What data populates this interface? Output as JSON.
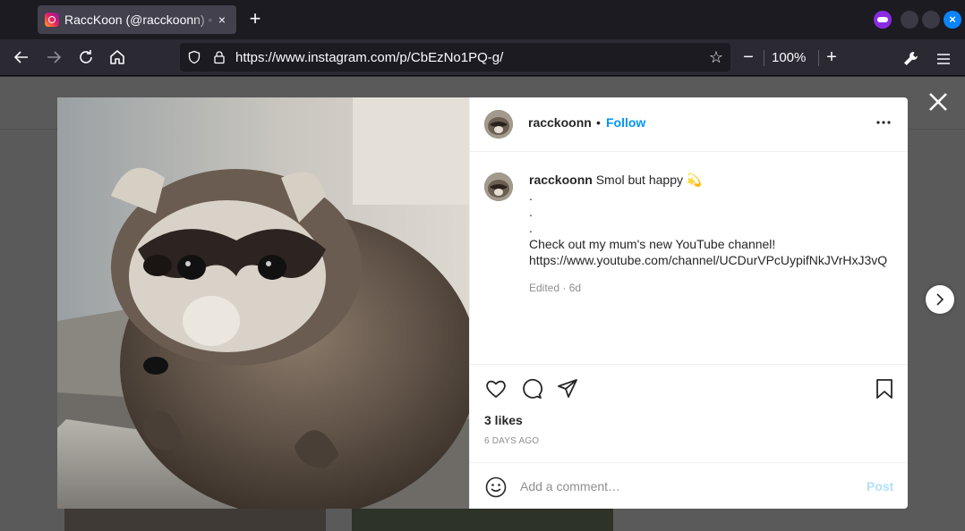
{
  "browser": {
    "tab_title": "RaccKoon (@racckoonn) • Instagram photos and videos",
    "tab_close": "×",
    "new_tab": "+",
    "url": "https://www.instagram.com/p/CbEzNo1PQ-g/",
    "zoom": "100%",
    "zoom_minus": "—",
    "zoom_plus": "+"
  },
  "post": {
    "username": "racckoonn",
    "separator": "•",
    "follow_label": "Follow",
    "caption_title": "Smol but happy 💫",
    "caption_lines": [
      ".",
      ".",
      ".",
      "Check out my mum's new YouTube channel!",
      "https://www.youtube.com/channel/UCDurVPcUypifNkJVrHxJ3vQ"
    ],
    "meta": "Edited · 6d",
    "likes": "3 likes",
    "time_ago": "6 DAYS AGO",
    "comment_placeholder": "Add a comment…",
    "post_label": "Post"
  },
  "colors": {
    "accent": "#0095f6",
    "post_disabled": "#b2dffc",
    "text": "#262626",
    "muted": "#8e8e8e",
    "browser_bg": "#2b2a33"
  },
  "icons": [
    "back-icon",
    "forward-icon",
    "reload-icon",
    "home-icon",
    "shield-icon",
    "lock-icon",
    "star-icon",
    "wrench-icon",
    "hamburger-menu-icon",
    "close-icon",
    "chevron-right-icon",
    "more-icon",
    "heart-icon",
    "comment-icon",
    "share-icon",
    "bookmark-icon",
    "emoji-icon"
  ]
}
